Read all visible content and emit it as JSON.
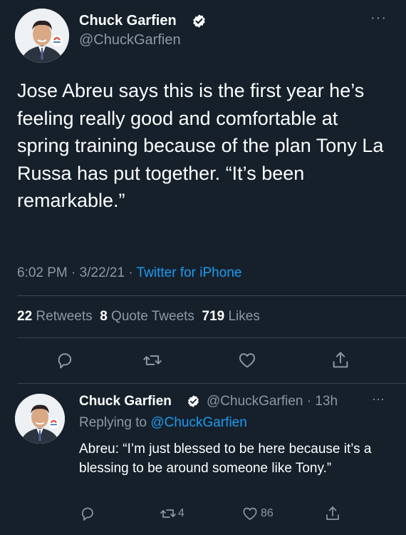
{
  "main_tweet": {
    "author_name": "Chuck Garfien",
    "handle": "@ChuckGarfien",
    "avatar_badge": "Sports CHICAGO",
    "more": "···",
    "text": "Jose Abreu says this is the first year he’s feeling really good and comfortable at spring training because of the plan Tony La Russa has put together.  “It’s been remarkable.”",
    "time": "6:02 PM",
    "date": "3/22/21",
    "source": "Twitter for iPhone",
    "retweets_count": "22",
    "retweets_label": "Retweets",
    "quotes_count": "8",
    "quotes_label": "Quote Tweets",
    "likes_count": "719",
    "likes_label": "Likes",
    "actions": [
      "reply-icon",
      "retweet-icon",
      "like-icon",
      "share-icon"
    ]
  },
  "reply_tweet": {
    "author_name": "Chuck Garfien",
    "handle": "@ChuckGarfien",
    "age": "13h",
    "more": "···",
    "replying_label": "Replying to",
    "replying_to": "@ChuckGarfien",
    "text": "Abreu: “I’m just blessed to be here because it’s a blessing to be around someone like Tony.”",
    "retweet_count": "4",
    "like_count": "86"
  },
  "colors": {
    "background": "#15202b",
    "secondary_text": "#8b98a5",
    "link": "#1d9bf0",
    "divider": "#38444d"
  }
}
